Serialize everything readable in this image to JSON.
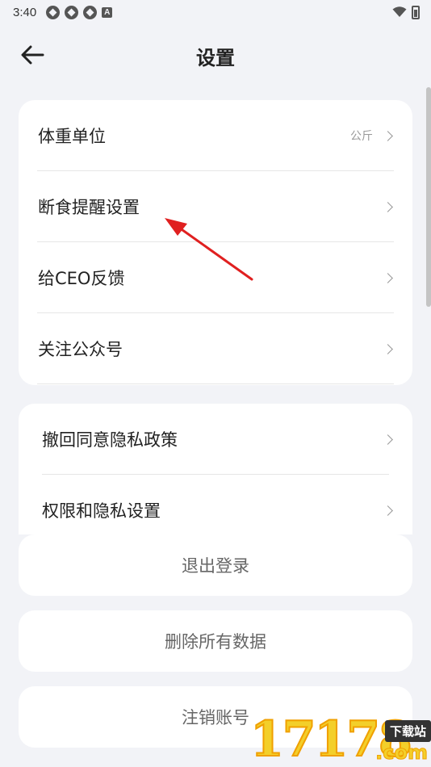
{
  "status_bar": {
    "time": "3:40",
    "icons": [
      "app-notification-icon",
      "app-notification-icon",
      "app-notification-icon",
      "a-square-icon"
    ],
    "right_icons": [
      "wifi-icon",
      "battery-icon"
    ]
  },
  "header": {
    "back_icon": "arrow-left-icon",
    "title": "设置"
  },
  "settings_group_1": [
    {
      "label": "体重单位",
      "value": "公斤"
    },
    {
      "label": "断食提醒设置",
      "value": ""
    },
    {
      "label": "给CEO反馈",
      "value": ""
    },
    {
      "label": "关注公众号",
      "value": ""
    }
  ],
  "settings_group_2": [
    {
      "label": "撤回同意隐私政策"
    },
    {
      "label": "权限和隐私设置"
    }
  ],
  "actions": {
    "logout": "退出登录",
    "delete_all": "删除所有数据",
    "cancel_account": "注销账号"
  },
  "annotation": {
    "color": "#e02020"
  },
  "watermark": {
    "digits": "17178",
    "tag": "下载站",
    "suffix": ".com"
  }
}
